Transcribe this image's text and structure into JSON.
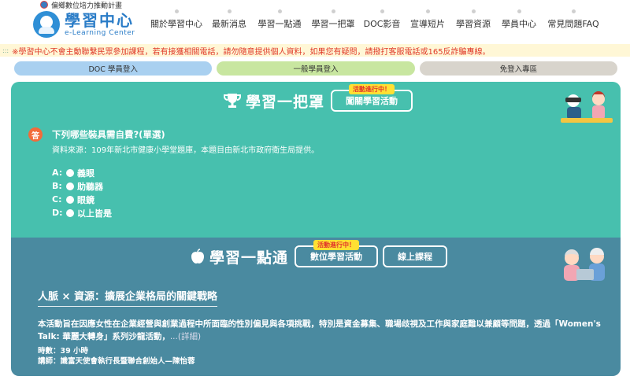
{
  "header": {
    "top_banner": "偏鄉數位培力推動計畫",
    "logo_title": "學習中心",
    "logo_subtitle": "e-Learning Center"
  },
  "nav": {
    "items": [
      {
        "label": "關於學習中心"
      },
      {
        "label": "最新消息"
      },
      {
        "label": "學習一點通"
      },
      {
        "label": "學習一把罩"
      },
      {
        "label": "DOC影音"
      },
      {
        "label": "宣導短片"
      },
      {
        "label": "學習資源"
      },
      {
        "label": "學員中心"
      },
      {
        "label": "常見問題FAQ"
      }
    ]
  },
  "notice": {
    "marker": ":::",
    "text": "※學習中心不會主動聯繫民眾參加課程，若有接獲相關電話，請勿隨意提供個人資料，如果您有疑問，請撥打客服電話或165反詐騙專線。"
  },
  "login_tabs": {
    "doc": "DOC 學員登入",
    "general": "一般學員登入",
    "guest": "免登入專區"
  },
  "quiz_section": {
    "title": "學習一把罩",
    "button_label": "闖關學習活動",
    "tag": "活動進行中！",
    "answer_badge": "答",
    "question": "下列哪些裝具需自費?(單選)",
    "source": "資料來源：109年新北市健康小學堂題庫，本題目由新北市政府衛生局提供。",
    "options": [
      {
        "letter": "A:",
        "text": "義眼"
      },
      {
        "letter": "B:",
        "text": "助聽器"
      },
      {
        "letter": "C:",
        "text": "眼鏡"
      },
      {
        "letter": "D:",
        "text": "以上皆是"
      }
    ]
  },
  "course_section": {
    "title": "學習一點通",
    "button_digital": "數位學習活動",
    "button_online": "線上課程",
    "tag": "活動進行中！",
    "course_title": "人脈 × 資源：擴展企業格局的關鍵戰略",
    "course_desc": "本活動旨在因應女性在企業經營與創業過程中所面臨的性別偏見與各項挑戰，特別是資金募集、職場歧視及工作與家庭難以兼顧等問題，透過「Women's Talk: 華麗大轉身」系列沙龍活動，",
    "more_link": "...(詳細)",
    "duration": "時數：39 小時",
    "lecturer": "講師：識富天使會執行長暨聯合創始人—陳怡蓉"
  },
  "colors": {
    "quiz_bg": "#47c0ae",
    "course_bg": "#4a8aa0",
    "notice_text": "#e03b2a",
    "brand_blue": "#2a7cc7"
  }
}
